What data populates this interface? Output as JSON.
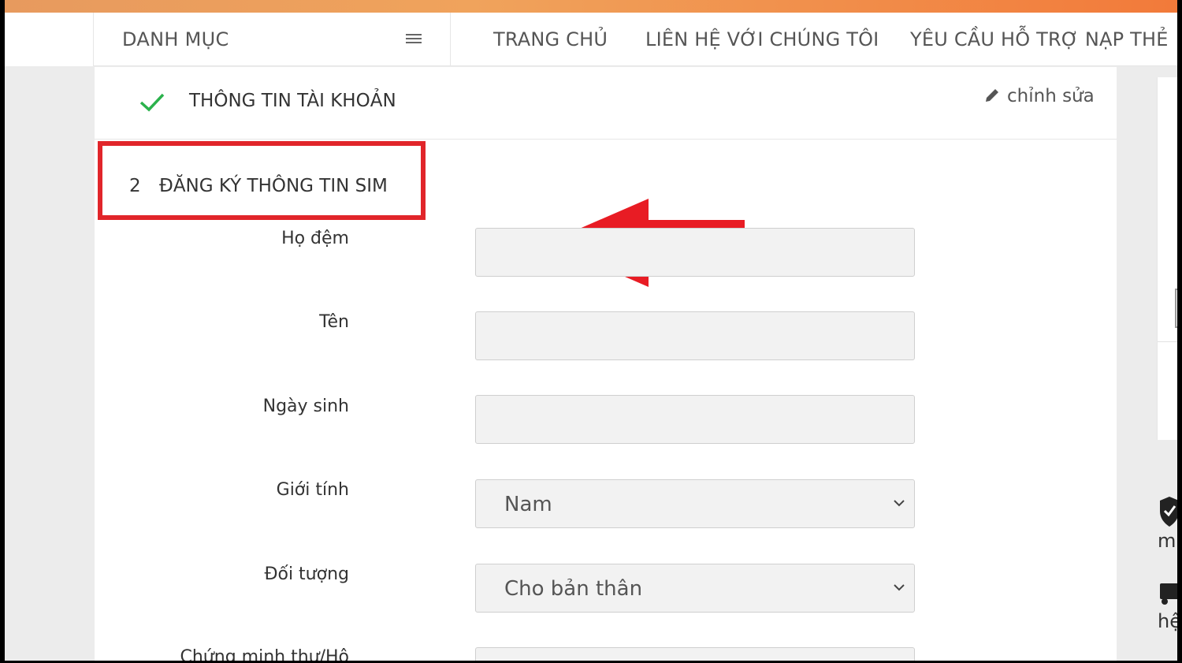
{
  "nav": {
    "category_label": "DANH MỤC",
    "links": [
      "TRANG CHỦ",
      "LIÊN HỆ VỚI CHÚNG TÔI",
      "YÊU CẦU HỖ TRỢ NẠP THẺ"
    ]
  },
  "account": {
    "title": "THÔNG TIN TÀI KHOẢN",
    "edit_label": "chỉnh sửa"
  },
  "sim_step": {
    "number": "2",
    "title": "ĐĂNG KÝ THÔNG TIN SIM"
  },
  "form": {
    "middle_name_label": "Họ đệm",
    "first_name_label": "Tên",
    "dob_label": "Ngày sinh",
    "gender_label": "Giới tính",
    "gender_value": "Nam",
    "subject_label": "Đối tượng",
    "subject_value": "Cho bản thân",
    "id_label": "Chứng minh thư/Hộ"
  },
  "side": {
    "text1": "m",
    "text2": "hệ"
  },
  "colors": {
    "highlight_red": "#e1252a",
    "check_green": "#2bb24c",
    "accent_orange": "#f27a3a"
  },
  "icons": [
    "hamburger-icon",
    "check-icon",
    "pencil-icon",
    "chevron-down-icon",
    "shield-icon",
    "truck-icon",
    "left-arrow-annotation"
  ]
}
